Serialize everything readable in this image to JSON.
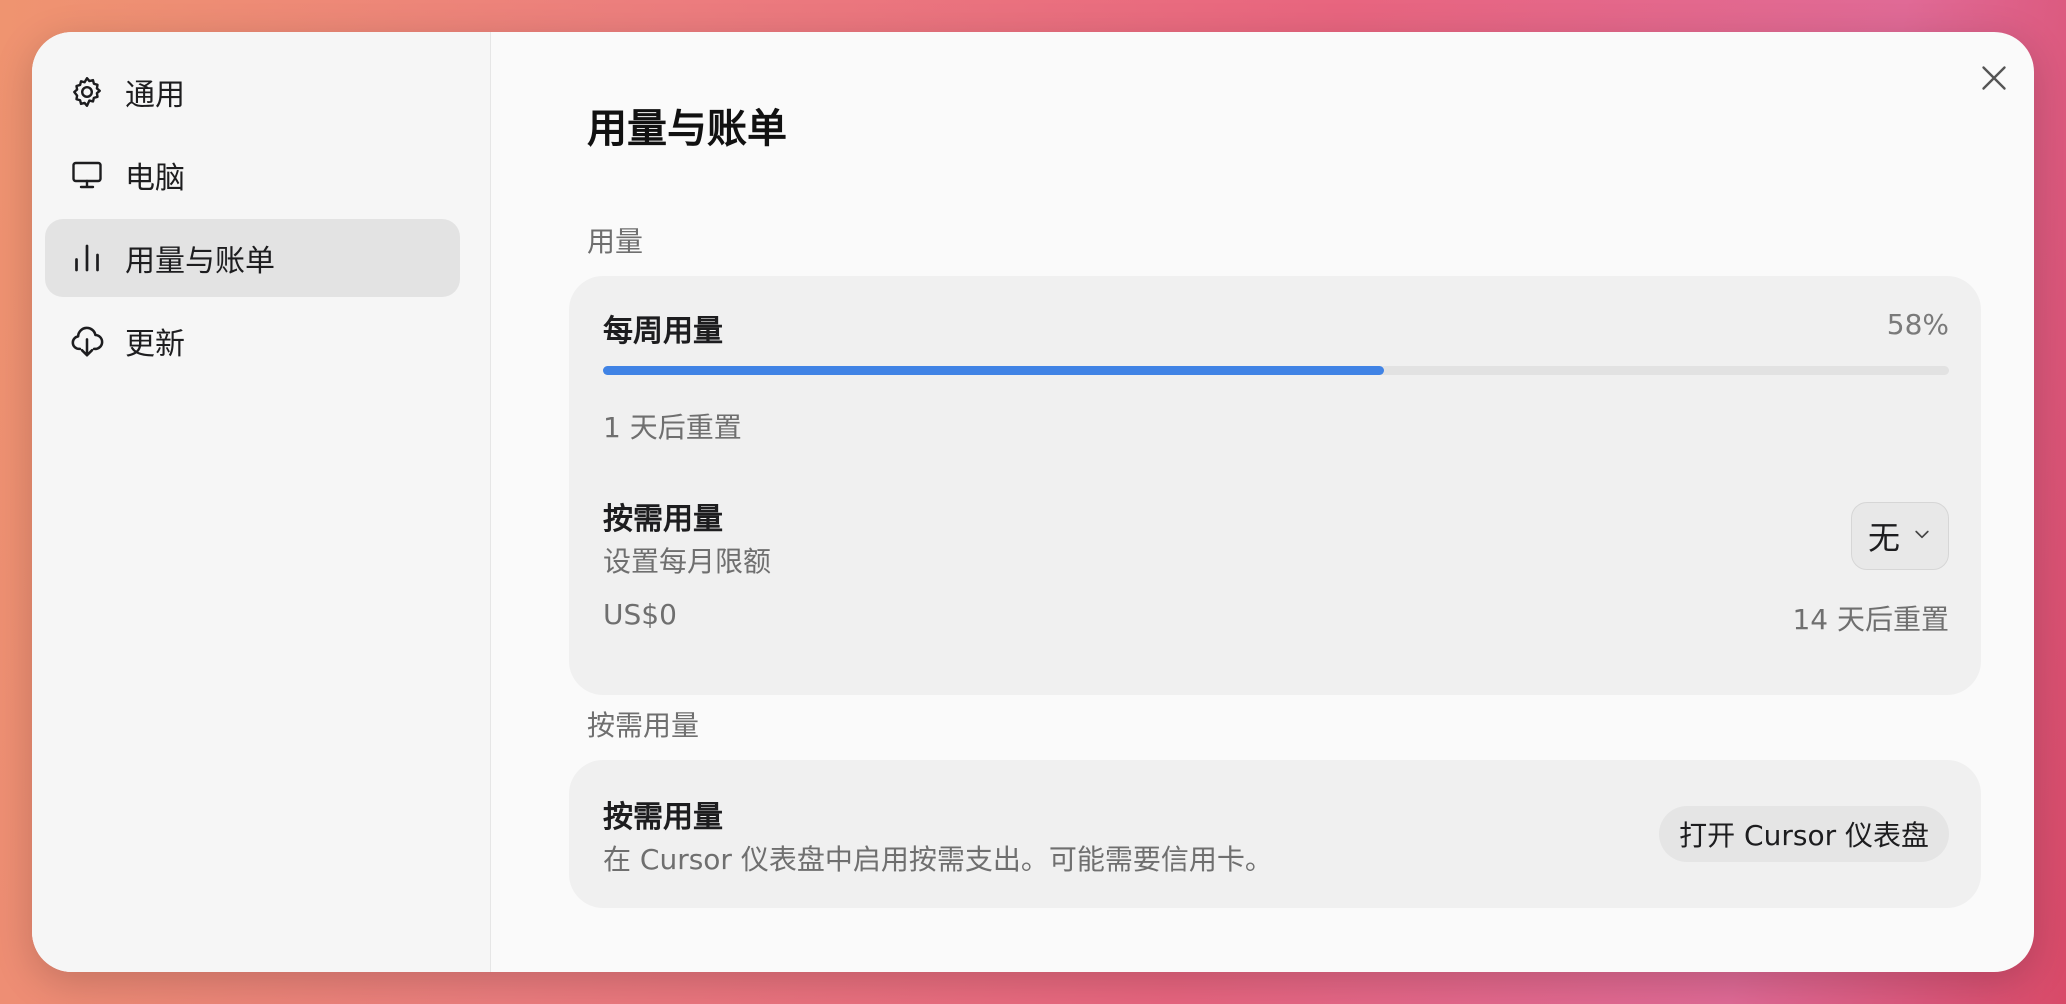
{
  "sidebar": {
    "items": [
      {
        "label": "通用",
        "icon": "gear-icon",
        "active": false
      },
      {
        "label": "电脑",
        "icon": "monitor-icon",
        "active": false
      },
      {
        "label": "用量与账单",
        "icon": "bar-chart-icon",
        "active": true
      },
      {
        "label": "更新",
        "icon": "cloud-download-icon",
        "active": false
      }
    ]
  },
  "main": {
    "title": "用量与账单",
    "usage_section": {
      "label": "用量",
      "weekly": {
        "title": "每周用量",
        "percent_label": "58%",
        "percent": 58,
        "reset_text": "1 天后重置",
        "bar_color": "#4083e5"
      },
      "on_demand": {
        "title": "按需用量",
        "subtitle": "设置每月限额",
        "limit_select": "无",
        "amount": "US$0",
        "reset_text": "14 天后重置"
      }
    },
    "on_demand_section": {
      "label": "按需用量",
      "title": "按需用量",
      "description": "在 Cursor 仪表盘中启用按需支出。可能需要信用卡。",
      "button_label": "打开 Cursor 仪表盘"
    }
  }
}
